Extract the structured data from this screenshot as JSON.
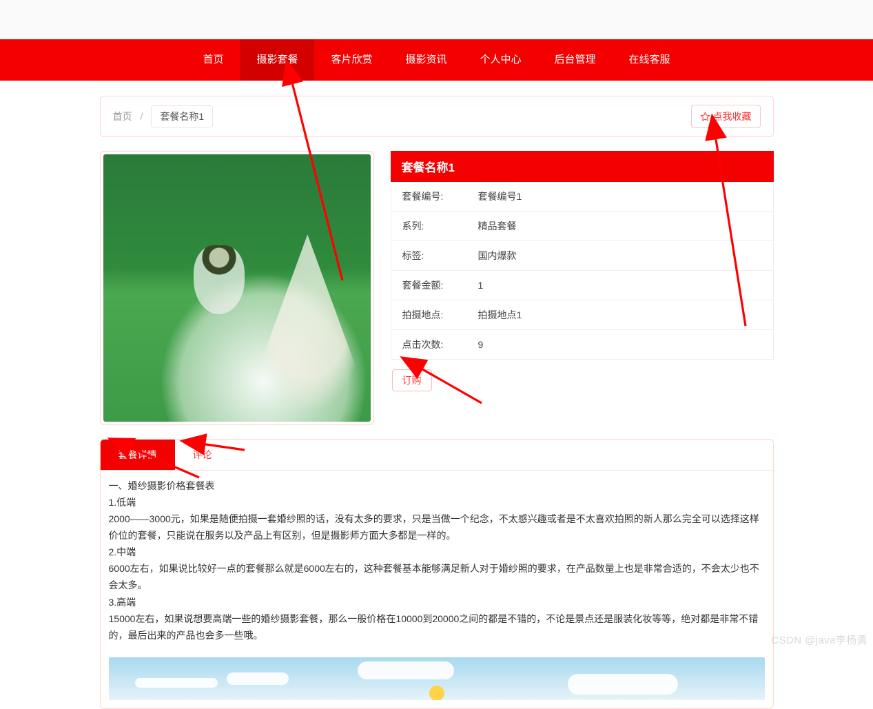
{
  "nav": {
    "items": [
      {
        "label": "首页"
      },
      {
        "label": "摄影套餐"
      },
      {
        "label": "客片欣赏"
      },
      {
        "label": "摄影资讯"
      },
      {
        "label": "个人中心"
      },
      {
        "label": "后台管理"
      },
      {
        "label": "在线客服"
      }
    ],
    "active_index": 1
  },
  "breadcrumb": {
    "home": "首页",
    "slash": "/",
    "current": "套餐名称1"
  },
  "favorite": {
    "label": "点我收藏"
  },
  "detail": {
    "title": "套餐名称1",
    "rows": [
      {
        "label": "套餐编号:",
        "value": "套餐编号1"
      },
      {
        "label": "系列:",
        "value": "精品套餐"
      },
      {
        "label": "标签:",
        "value": "国内爆款"
      },
      {
        "label": "套餐金额:",
        "value": "1"
      },
      {
        "label": "拍摄地点:",
        "value": "拍摄地点1"
      },
      {
        "label": "点击次数:",
        "value": "9"
      }
    ],
    "order_label": "订购"
  },
  "tabs": {
    "items": [
      {
        "label": "套餐详情"
      },
      {
        "label": "评论"
      }
    ],
    "active_index": 0
  },
  "content": {
    "lines": [
      "一、婚纱摄影价格套餐表",
      "1.低端",
      "2000——3000元，如果是随便拍摄一套婚纱照的话，没有太多的要求，只是当做一个纪念，不太感兴趣或者是不太喜欢拍照的新人那么完全可以选择这样价位的套餐，只能说在服务以及产品上有区别，但是摄影师方面大多都是一样的。",
      "2.中端",
      "6000左右，如果说比较好一点的套餐那么就是6000左右的，这种套餐基本能够满足新人对于婚纱照的要求，在产品数量上也是非常合适的，不会太少也不会太多。",
      "3.高端",
      "15000左右，如果说想要高端一些的婚纱摄影套餐，那么一般价格在10000到20000之间的都是不错的，不论是景点还是服装化妆等等，绝对都是非常不错的，最后出来的产品也会多一些哦。"
    ]
  },
  "watermark": "CSDN @java李杨勇"
}
